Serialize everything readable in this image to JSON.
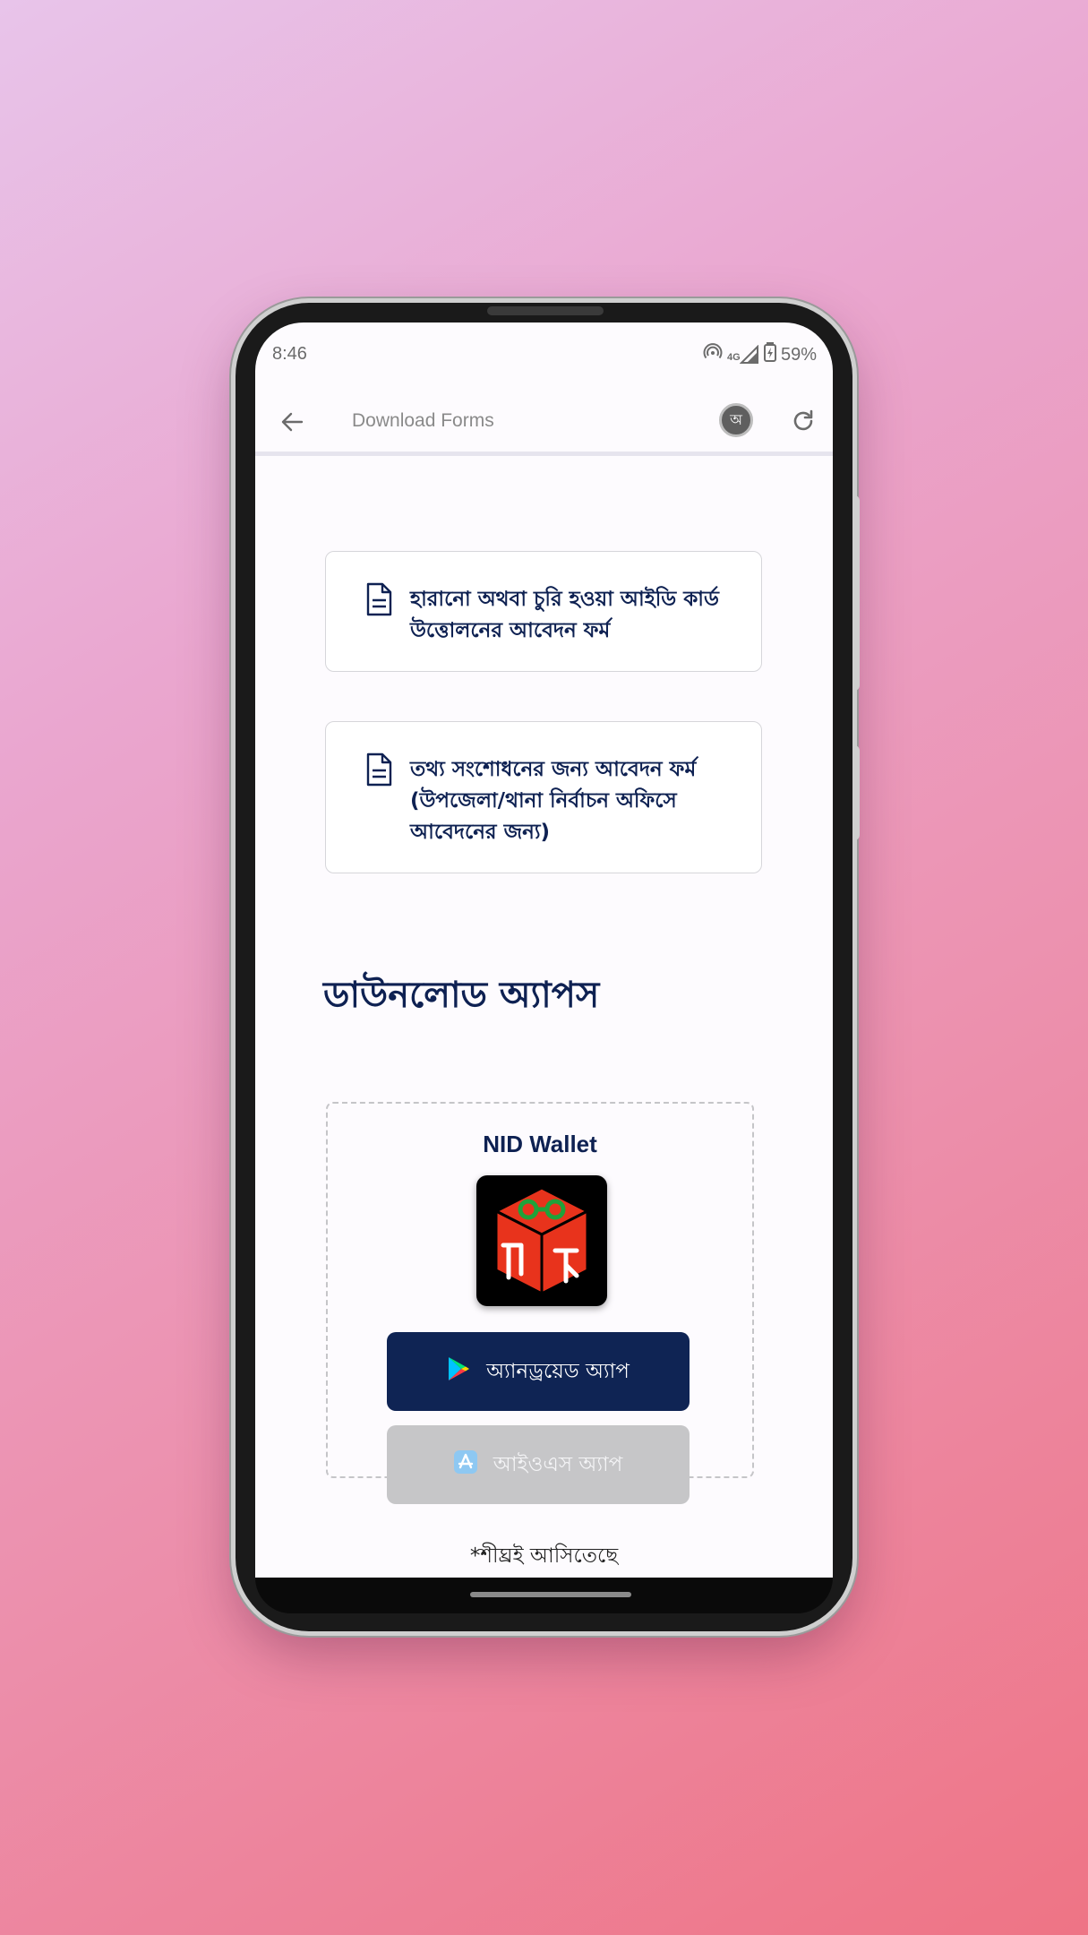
{
  "status_bar": {
    "time": "8:46",
    "network": "4G",
    "battery": "59%",
    "icons": [
      "hotspot-icon",
      "signal-icon",
      "battery-icon"
    ]
  },
  "app_bar": {
    "title": "Download Forms",
    "back_icon": "arrow-left-icon",
    "language_toggle": "অ",
    "refresh_icon": "refresh-icon"
  },
  "forms": [
    {
      "icon": "document-icon",
      "title_lines": [
        "হারানো অথবা চুরি হওয়া আইডি কার্ড",
        "উত্তোলনের আবেদন ফর্ম"
      ]
    },
    {
      "icon": "document-icon",
      "title_lines": [
        "তথ্য সংশোধনের জন্য আবেদন ফর্ম",
        "(উপজেলা/থানা নির্বাচন অফিসে",
        "আবেদনের জন্য)"
      ]
    }
  ],
  "apps_section": {
    "heading": "ডাউনলোড অ্যাপস",
    "app": {
      "name": "NID Wallet",
      "logo_icon": "nid-wallet-logo-icon",
      "android_label": "অ্যানড্রয়েড অ্যাপ",
      "ios_label": "আইওএস অ্যাপ",
      "note": "*শীঘ্রই আসিতেছে"
    }
  },
  "colors": {
    "primary": "#0f2454",
    "disabled_button": "#c6c6c8",
    "logo_cube": "#e8331c",
    "logo_gear": "#1fa23a"
  }
}
